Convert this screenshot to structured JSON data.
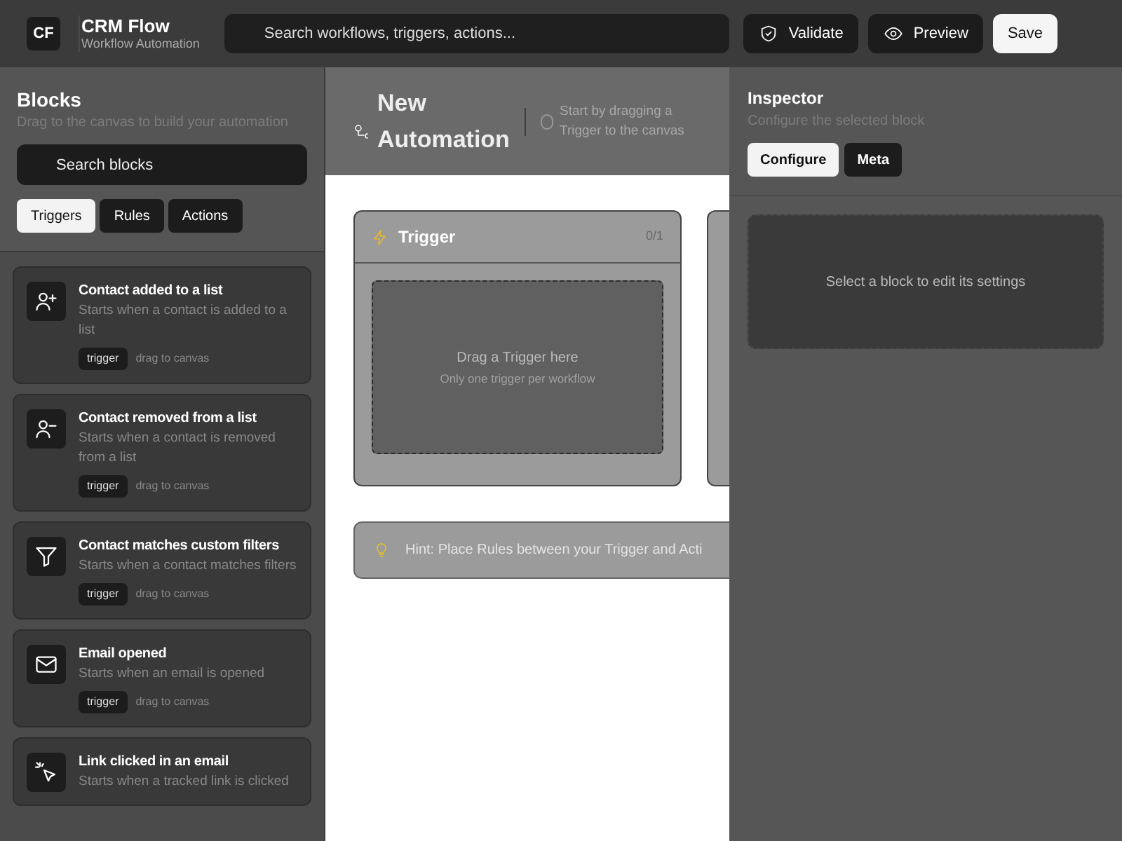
{
  "header": {
    "logo": "CF",
    "app_name": "CRM Flow",
    "app_subtitle": "Workflow Automation",
    "search": {
      "placeholder": "Search workflows, triggers, actions..."
    },
    "buttons": [
      {
        "label": "Validate",
        "kind": "shield"
      },
      {
        "label": "Preview",
        "kind": "eye"
      },
      {
        "label": "Save",
        "kind": "primary"
      }
    ]
  },
  "sidebar": {
    "title": "Blocks",
    "subtitle": "Drag to the canvas to build your automation",
    "search": {
      "placeholder": "Search blocks"
    },
    "tabs": [
      {
        "label": "Triggers",
        "selected": true
      },
      {
        "label": "Rules",
        "selected": false
      },
      {
        "label": "Actions",
        "selected": false
      }
    ],
    "items": [
      {
        "kind": "user-plus",
        "title": "Contact added to a list",
        "description": "Starts when a contact is added to a list",
        "tag": "trigger",
        "hint": "drag to canvas"
      },
      {
        "kind": "user-minus",
        "title": "Contact removed from a list",
        "description": "Starts when a contact is removed from a list",
        "tag": "trigger",
        "hint": "drag to canvas"
      },
      {
        "kind": "filter",
        "title": "Contact matches custom filters",
        "description": "Starts when a contact matches filters",
        "tag": "trigger",
        "hint": "drag to canvas"
      },
      {
        "kind": "mail",
        "title": "Email opened",
        "description": "Starts when an email is opened",
        "tag": "trigger",
        "hint": "drag to canvas"
      },
      {
        "kind": "click",
        "title": "Link clicked in an email",
        "description": "Starts when a tracked link is clicked"
      }
    ]
  },
  "canvas": {
    "title": "New Automation",
    "subtitle": "Start by dragging a Trigger to the canvas",
    "columns": [
      {
        "title": "Trigger",
        "count": "0/1",
        "drop_title": "Drag a Trigger here",
        "drop_subtitle": "Only one trigger per workflow"
      }
    ],
    "hint": "Hint: Place Rules between your Trigger and Acti"
  },
  "inspector": {
    "title": "Inspector",
    "subtitle": "Configure the selected block",
    "tabs": [
      {
        "label": "Configure",
        "selected": true
      },
      {
        "label": "Meta",
        "selected": false
      }
    ],
    "empty_text": "Select a block to edit its settings"
  }
}
